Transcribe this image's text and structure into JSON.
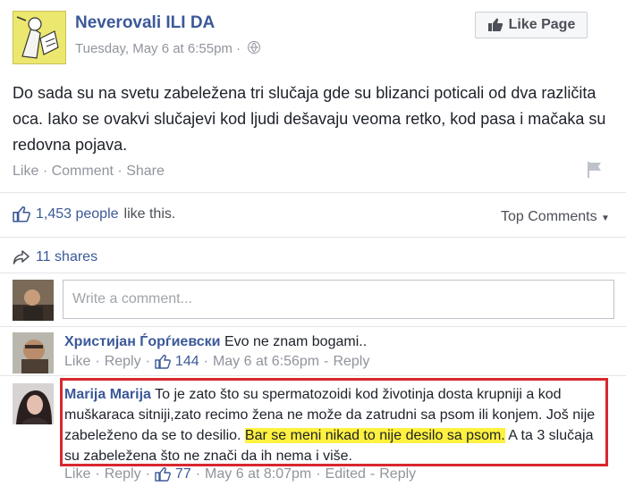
{
  "post": {
    "page_name": "Neverovali ILI DA",
    "timestamp": "Tuesday, May 6 at 6:55pm",
    "sep": "·",
    "like_page_label": "Like Page",
    "text": "Do sada su na svetu zabeležena tri slučaja gde su blizanci poticali od dva različita oca. Iako se ovakvi slučajevi kod ljudi dešavaju veoma retko, kod pasa i mačaka su redovna pojava.",
    "actions": {
      "like": "Like",
      "comment": "Comment",
      "share": "Share",
      "sep": "·"
    }
  },
  "summary": {
    "likes_count": "1,453 people",
    "likes_suffix": "like this.",
    "top_comments": "Top Comments",
    "shares": "11 shares"
  },
  "composer": {
    "placeholder": "Write a comment..."
  },
  "comments": [
    {
      "author": "Христијан Ѓорѓиевски",
      "text": "Evo ne znam bogami..",
      "like": "Like",
      "reply": "Reply",
      "sep": "·",
      "likes": "144",
      "time": "May 6 at 6:56pm",
      "dash": "-",
      "reply2": "Reply"
    },
    {
      "author": "Marija Marija",
      "text_before": "To je zato što su spermatozoidi kod životinja dosta krupniji a kod muškaraca sitniji,zato recimo žena ne može da zatrudni sa psom ili konjem. Još nije zabeleženo da se to desilio.",
      "text_highlight": "Bar se meni nikad to nije desilo sa psom.",
      "text_after": "A ta 3 slučaja su zabeležena što ne znači da ih nema i više.",
      "like": "Like",
      "reply": "Reply",
      "sep": "·",
      "likes": "77",
      "time": "May 6 at 8:07pm",
      "dash": "-",
      "edited": "Edited",
      "reply2": "Reply"
    }
  ],
  "colors": {
    "link_blue": "#3b5998",
    "meta_grey": "#90949c",
    "highlight": "#fff13f",
    "annotation_red": "#d9272e"
  }
}
